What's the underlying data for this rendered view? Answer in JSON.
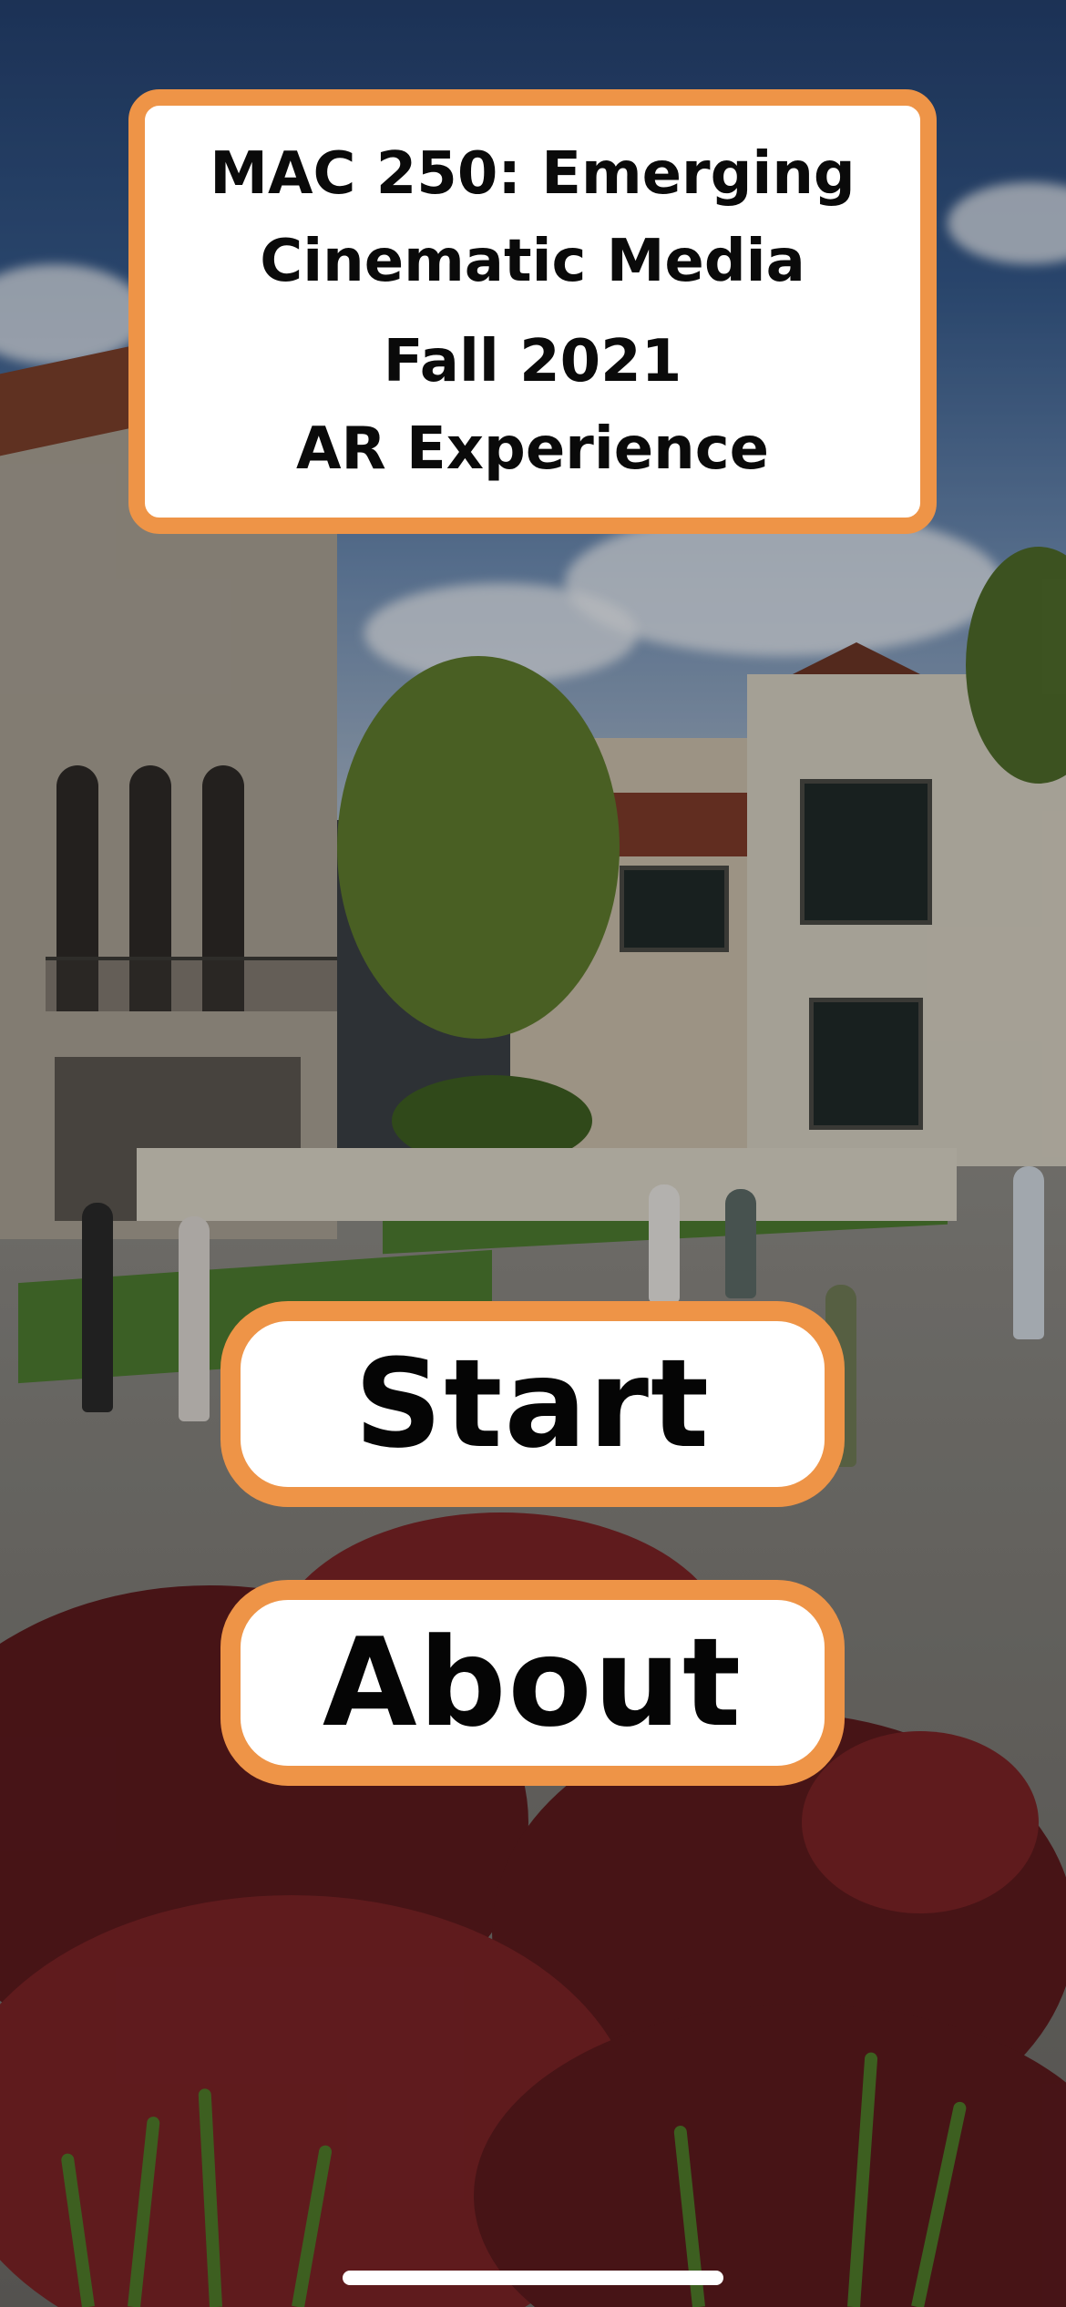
{
  "title_card": {
    "course_line_1": "MAC 250: Emerging",
    "course_line_2": "Cinematic Media",
    "term": "Fall 2021",
    "subtitle": "AR Experience"
  },
  "buttons": {
    "start_label": "Start",
    "about_label": "About"
  },
  "theme": {
    "accent": "#ee9447",
    "card_background": "#ffffff",
    "text": "#0a0a0a"
  },
  "background": {
    "icon": "campus-photo-background"
  }
}
